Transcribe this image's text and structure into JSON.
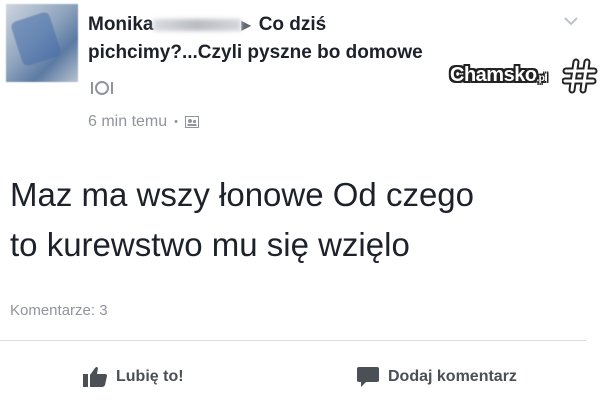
{
  "post": {
    "author_name": "Monika",
    "arrow_glyph": "▶",
    "group_name_part1": "Co dziś",
    "group_name_part2": "pichcimy?...Czyli pyszne bo domowe",
    "food_icon": "plate-fork-knife-icon",
    "timestamp": "6 min temu",
    "separator": "•",
    "privacy_icon": "group-privacy-icon",
    "body_line1": "Maz ma wszy łonowe Od czego",
    "body_line2": "to kurewstwo mu się wzięlo",
    "comments_count_label": "Komentarze: 3"
  },
  "actions": {
    "like_label": "Lubię to!",
    "comment_label": "Dodaj komentarz"
  },
  "watermark": {
    "text": "Chamsko",
    "suffix": ".pl"
  },
  "colors": {
    "text_primary": "#1d2129",
    "text_secondary": "#90949c",
    "action_text": "#4b4f56"
  }
}
